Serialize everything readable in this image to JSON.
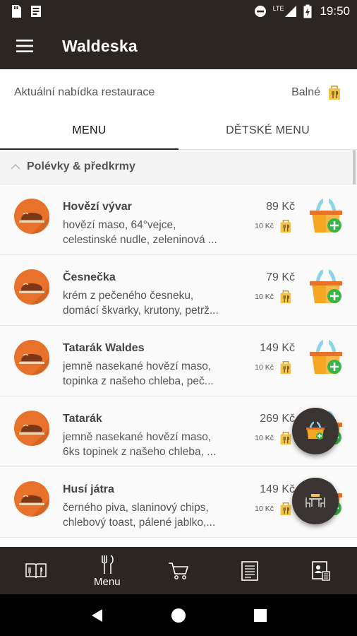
{
  "status_bar": {
    "time": "19:50",
    "network": "LTE"
  },
  "app": {
    "title": "Waldeska"
  },
  "subheader": {
    "text": "Aktuální nabídka restaurace",
    "location": "Balné"
  },
  "tabs": [
    {
      "label": "MENU",
      "active": true
    },
    {
      "label": "DĚTSKÉ MENU",
      "active": false
    }
  ],
  "section": {
    "title": "Polévky & předkrmy"
  },
  "items": [
    {
      "name": "Hovězí vývar",
      "desc1": "hovězí maso, 64°vejce,",
      "desc2": "celestinské nudle, zeleninová ...",
      "price": "89 Kč",
      "pack": "10 Kč"
    },
    {
      "name": "Česnečka",
      "desc1": "krém z pečeného česneku,",
      "desc2": "domácí škvarky, krutony, petrž...",
      "price": "79 Kč",
      "pack": "10 Kč"
    },
    {
      "name": "Tatarák Waldes",
      "desc1": "jemně nasekané hovězí maso,",
      "desc2": "topinka z našeho chleba, peč...",
      "price": "149 Kč",
      "pack": "10 Kč"
    },
    {
      "name": "Tatarák",
      "desc1": "jemně nasekané hovězí maso,",
      "desc2": "6ks topinek z našeho chleba, ...",
      "price": "269 Kč",
      "pack": "10 Kč"
    },
    {
      "name": "Husí játra",
      "desc1": "černého piva, slaninový chips,",
      "desc2": "chlebový toast, pálené jablko,...",
      "price": "149 Kč",
      "pack": "10 Kč"
    }
  ],
  "bottom_nav": [
    {
      "icon": "menu-book-icon",
      "label": ""
    },
    {
      "icon": "fork-knife-icon",
      "label": "Menu"
    },
    {
      "icon": "cart-icon",
      "label": ""
    },
    {
      "icon": "receipt-icon",
      "label": ""
    },
    {
      "icon": "profile-card-icon",
      "label": ""
    }
  ],
  "colors": {
    "bar": "#2b2622",
    "accent_orange": "#e8722c",
    "basket": "#f5a623",
    "plus": "#3ab54a"
  }
}
